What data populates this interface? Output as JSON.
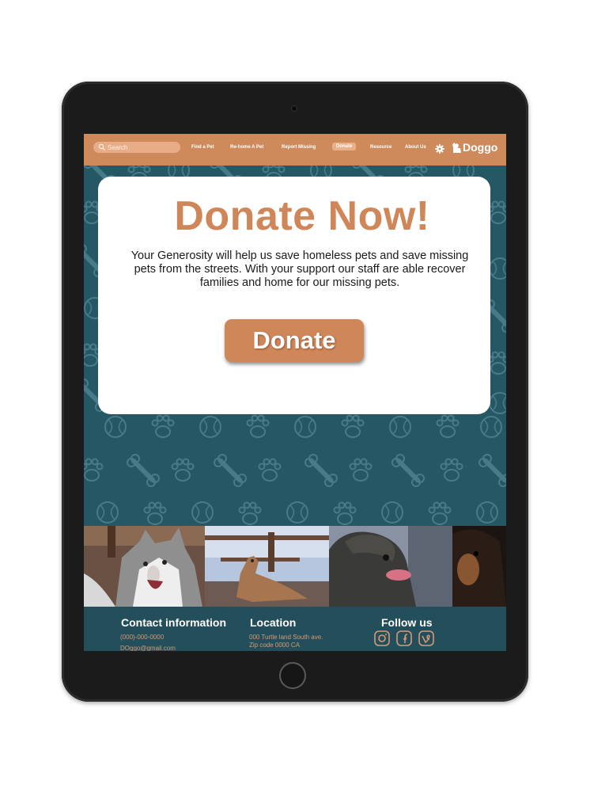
{
  "nav": {
    "search_placeholder": "Search",
    "items": [
      "Find a Pet",
      "Re-home A Pet",
      "Report Missing",
      "Donate",
      "Resource",
      "About Us"
    ],
    "active": "Donate",
    "logo_text": "Doggo"
  },
  "hero": {
    "title": "Donate Now!",
    "description": "Your Generosity will help us save homeless pets and save missing pets from the streets. With your support our staff are able recover families and home for our missing pets.",
    "button_label": "Donate"
  },
  "footer": {
    "contact_heading": "Contact information",
    "phone": "(000)-000-0000",
    "email": "DOggo@gmail.com",
    "location_heading": "Location",
    "address_line1": "000 Turtle land South ave.",
    "address_line2": "Zip code 0000 CA",
    "follow_heading": "Follow us",
    "social_icons": [
      "instagram-icon",
      "facebook-icon",
      "vine-icon"
    ]
  },
  "colors": {
    "accent": "#cf8659",
    "nav_bg": "#cf8a5c",
    "page_bg": "#255764",
    "footer_bg": "#234e5b"
  }
}
